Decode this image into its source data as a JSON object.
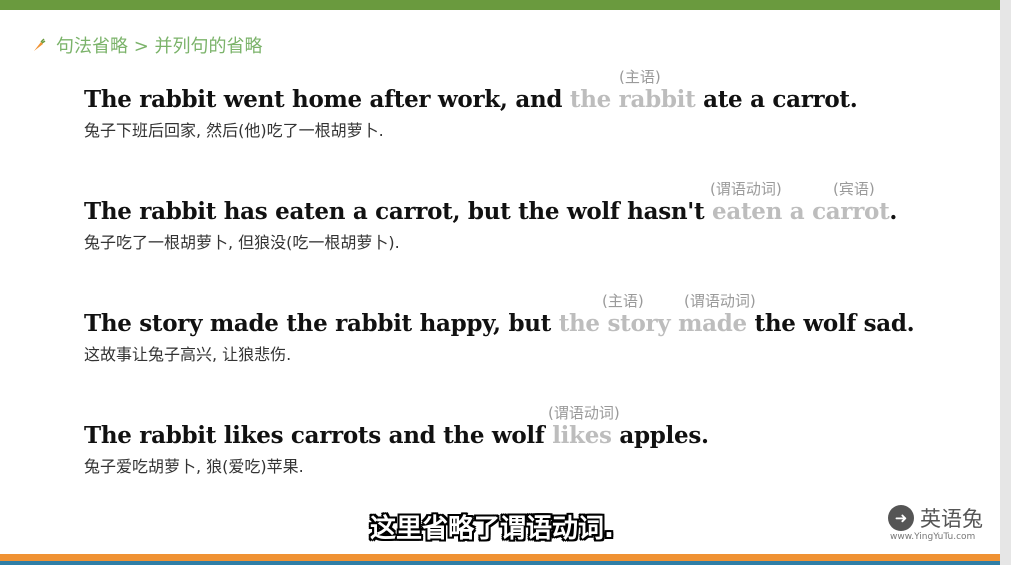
{
  "breadcrumb": "句法省略 > 并列句的省略",
  "examples": [
    {
      "notes": [
        "(主语)"
      ],
      "before": "The rabbit went home after work, and ",
      "omitted1": "the rabbit",
      "mid": " ate a carrot.",
      "omitted2": "",
      "after": "",
      "translation": "兔子下班后回家, 然后(他)吃了一根胡萝卜."
    },
    {
      "notes": [
        "(谓语动词)",
        "(宾语)"
      ],
      "before": "The rabbit has eaten a carrot, but the wolf hasn't ",
      "omitted1": "eaten a carrot",
      "mid": ".",
      "omitted2": "",
      "after": "",
      "translation": "兔子吃了一根胡萝卜, 但狼没(吃一根胡萝卜)."
    },
    {
      "notes": [
        "(主语)",
        "(谓语动词)"
      ],
      "before": "The story made the rabbit happy, but ",
      "omitted1": "the story made",
      "mid": " the wolf sad.",
      "omitted2": "",
      "after": "",
      "translation": "这故事让兔子高兴, 让狼悲伤."
    },
    {
      "notes": [
        "(谓语动词)"
      ],
      "before": "The rabbit likes carrots and the wolf ",
      "omitted1": "likes",
      "mid": " apples.",
      "omitted2": "",
      "after": "",
      "translation": "兔子爱吃胡萝卜, 狼(爱吃)苹果."
    }
  ],
  "subtitle": "这里省略了谓语动词.",
  "logo": {
    "name": "英语兔",
    "url": "www.YingYuTu.com"
  },
  "colors": {
    "top_bar": "#6a9a3e",
    "breadcrumb": "#7bb36a",
    "omitted": "#bdbdbd",
    "bottom_bar": "#f09233"
  }
}
